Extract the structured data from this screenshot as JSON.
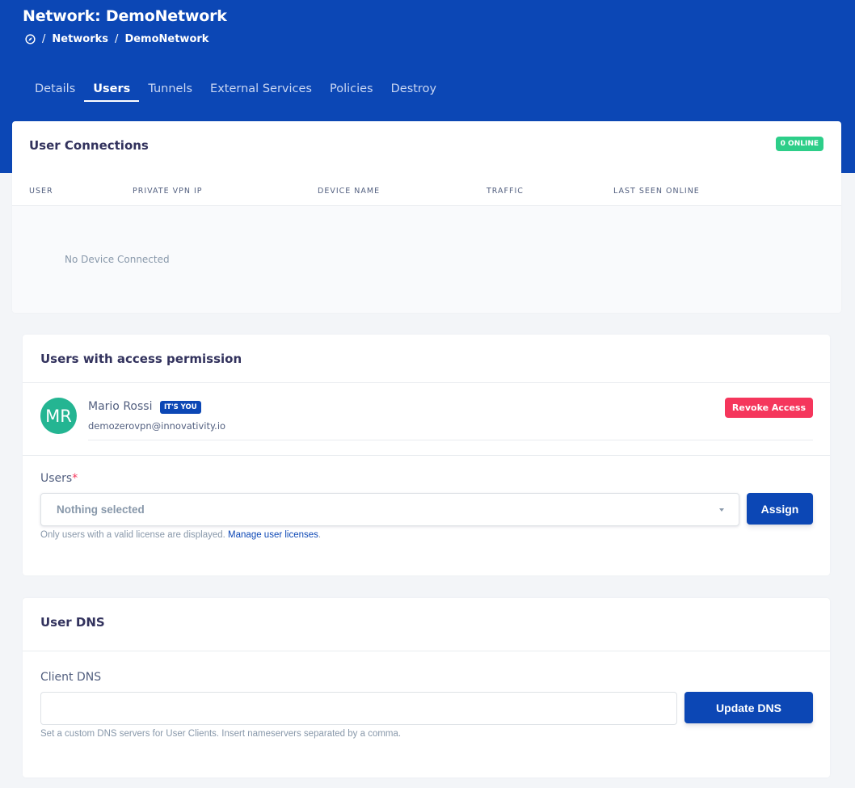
{
  "header": {
    "title": "Network: DemoNetwork",
    "breadcrumb": [
      "Networks",
      "DemoNetwork"
    ],
    "breadcrumb_separator": "/"
  },
  "tabs": [
    {
      "label": "Details",
      "active": false
    },
    {
      "label": "Users",
      "active": true
    },
    {
      "label": "Tunnels",
      "active": false
    },
    {
      "label": "External Services",
      "active": false
    },
    {
      "label": "Policies",
      "active": false
    },
    {
      "label": "Destroy",
      "active": false
    }
  ],
  "connections": {
    "title": "User Connections",
    "online_badge": "0 ONLINE",
    "columns": [
      "USER",
      "PRIVATE VPN IP",
      "DEVICE NAME",
      "TRAFFIC",
      "LAST SEEN ONLINE"
    ],
    "empty_message": "No Device Connected"
  },
  "permissions": {
    "title": "Users with access permission",
    "user": {
      "initials": "MR",
      "name": "Mario Rossi",
      "badge": "IT'S YOU",
      "email": "demozerovpn@innovativity.io"
    },
    "revoke_label": "Revoke Access",
    "users_label": "Users",
    "required_mark": "*",
    "select_placeholder": "Nothing selected",
    "assign_label": "Assign",
    "help_text": "Only users with a valid license are displayed.",
    "help_link": "Manage user licenses",
    "help_suffix": "."
  },
  "dns": {
    "title": "User DNS",
    "field_label": "Client DNS",
    "value": "",
    "button_label": "Update DNS",
    "help_text": "Set a custom DNS servers for User Clients. Insert nameservers separated by a comma."
  },
  "colors": {
    "brand": "#0c47b5",
    "success": "#2dce89",
    "danger": "#f5365c",
    "avatar": "#24b592"
  },
  "icons": {
    "breadcrumb_home": "compass-icon",
    "select_caret": "caret-down-icon"
  }
}
